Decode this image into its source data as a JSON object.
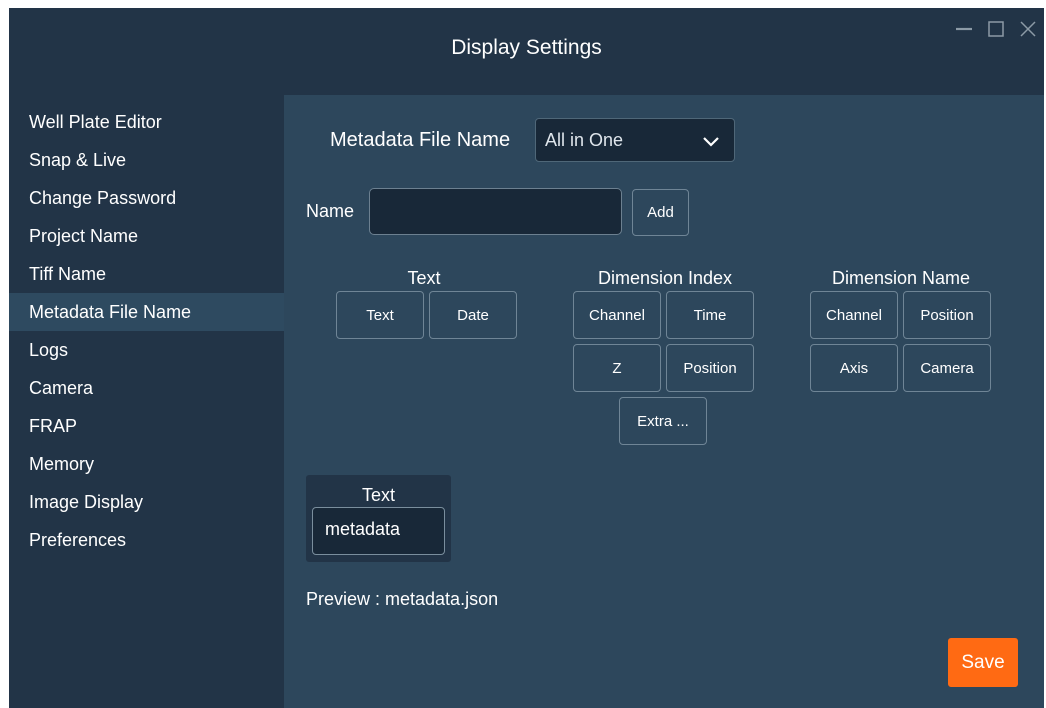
{
  "window": {
    "title": "Display Settings"
  },
  "sidebar": {
    "items": [
      {
        "label": "Well Plate Editor"
      },
      {
        "label": "Snap & Live"
      },
      {
        "label": "Change Password"
      },
      {
        "label": "Project Name"
      },
      {
        "label": "Tiff Name"
      },
      {
        "label": "Metadata File Name",
        "active": true
      },
      {
        "label": "Logs"
      },
      {
        "label": "Camera"
      },
      {
        "label": "FRAP"
      },
      {
        "label": "Memory"
      },
      {
        "label": "Image Display"
      },
      {
        "label": "Preferences"
      }
    ]
  },
  "main": {
    "metadata_label": "Metadata File Name",
    "metadata_select_value": "All in One",
    "name_label": "Name",
    "name_value": "",
    "add_label": "Add",
    "groups": {
      "text": {
        "title": "Text",
        "buttons": [
          "Text",
          "Date"
        ]
      },
      "dimension_index": {
        "title": "Dimension Index",
        "buttons": [
          "Channel",
          "Time",
          "Z",
          "Position",
          "Extra ..."
        ]
      },
      "dimension_name": {
        "title": "Dimension Name",
        "buttons": [
          "Channel",
          "Position",
          "Axis",
          "Camera"
        ]
      }
    },
    "text_block": {
      "label": "Text",
      "value": "metadata"
    },
    "preview": "Preview : metadata.json",
    "save_label": "Save"
  },
  "colors": {
    "background": "#223447",
    "panel": "#2d475c",
    "input": "#182838",
    "accent": "#ff6a13"
  },
  "icons": [
    "minimize-icon",
    "maximize-icon",
    "close-icon",
    "chevron-down-icon"
  ]
}
